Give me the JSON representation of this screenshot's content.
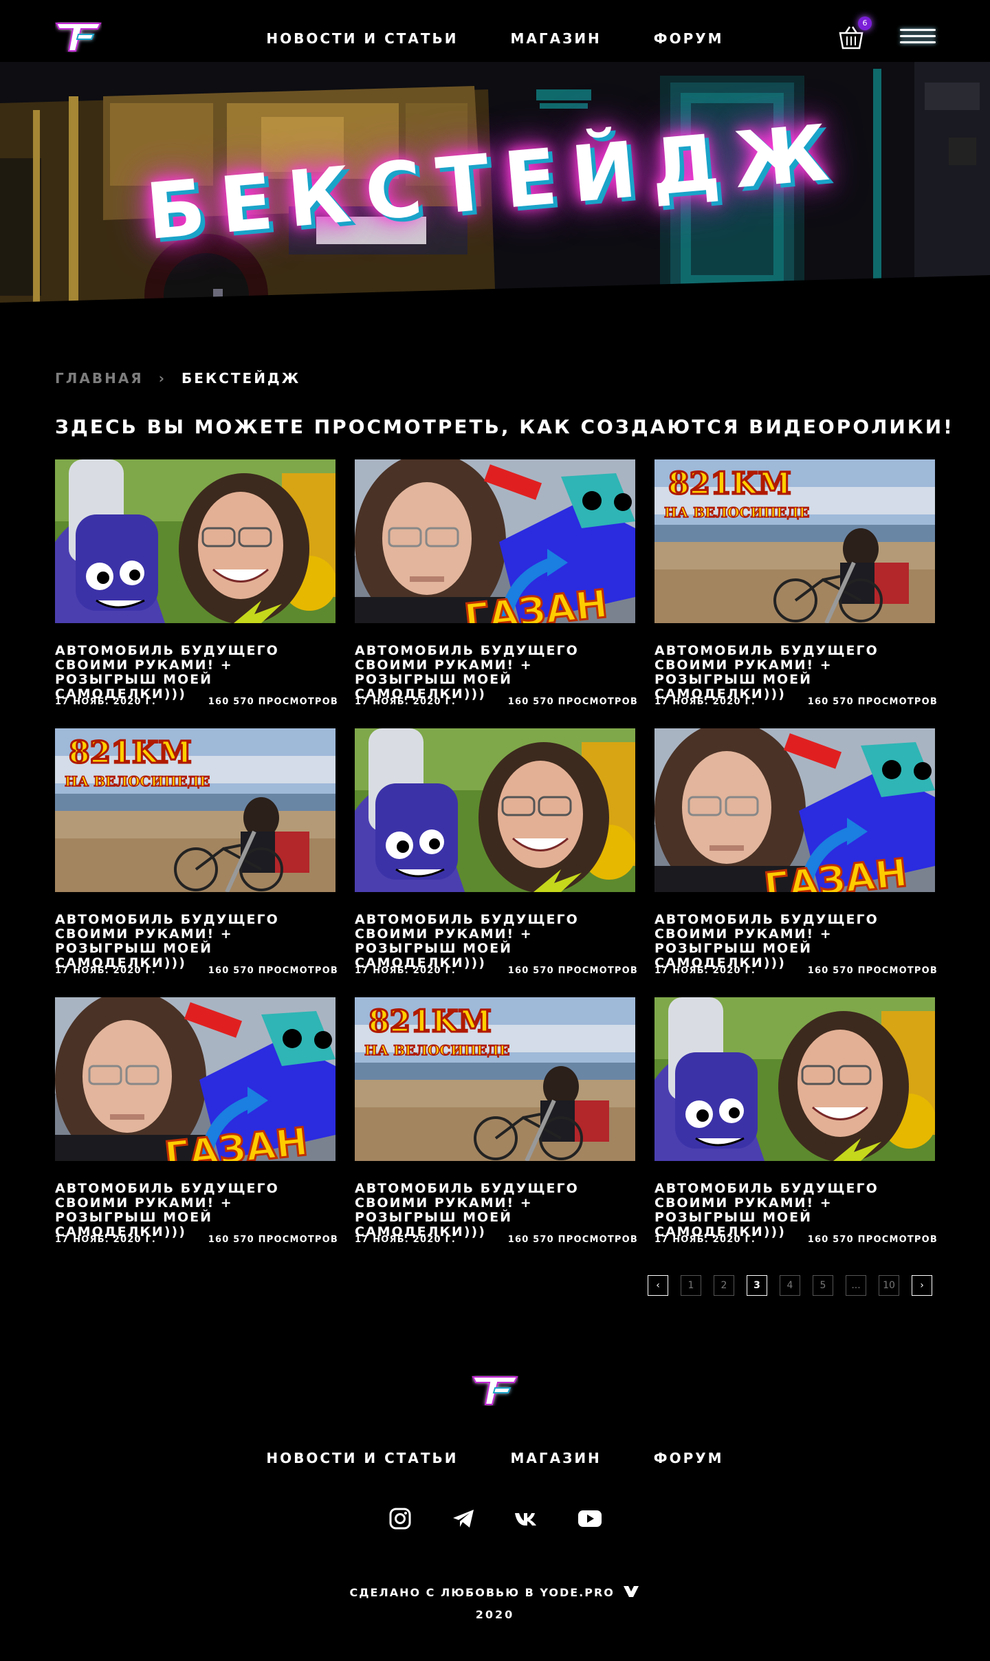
{
  "header": {
    "logo_icon": "tf-logo-icon",
    "nav": [
      "НОВОСТИ И СТАТЬИ",
      "МАГАЗИН",
      "ФОРУМ"
    ],
    "cart_icon": "basket-icon",
    "cart_count": "6",
    "menu_icon": "hamburger-menu-icon",
    "accent_color": "#a855f7"
  },
  "hero": {
    "title": "БЕКСТЕЙДЖ",
    "glow_color": "#ff3cd8",
    "shadow_color": "#1aa3c9"
  },
  "breadcrumb": {
    "home": "ГЛАВНАЯ",
    "separator_icon": "chevron-right-icon",
    "current": "БЕКСТЕЙДЖ"
  },
  "intro": "ЗДЕСЬ ВЫ МОЖЕТЕ ПРОСМОТРЕТЬ, КАК СОЗДАЮТСЯ ВИДЕОРОЛИКИ!",
  "videos": [
    {
      "thumb": "smile",
      "title": "АВТОМОБИЛЬ БУДУЩЕГО СВОИМИ РУКАМИ! + РОЗЫГРЫШ МОЕЙ САМОДЕЛКИ)))",
      "date": "17 НОЯБ. 2020 Г.",
      "views": "160 570 ПРОСМОТРОВ"
    },
    {
      "thumb": "car",
      "title": "АВТОМОБИЛЬ БУДУЩЕГО СВОИМИ РУКАМИ! + РОЗЫГРЫШ МОЕЙ САМОДЕЛКИ)))",
      "date": "17 НОЯБ. 2020 Г.",
      "views": "160 570 ПРОСМОТРОВ"
    },
    {
      "thumb": "bike",
      "overlay_km": "821KM",
      "overlay_sub": "НА ВЕЛОСИПЕДЕ",
      "title": "АВТОМОБИЛЬ БУДУЩЕГО СВОИМИ РУКАМИ! + РОЗЫГРЫШ МОЕЙ САМОДЕЛКИ)))",
      "date": "17 НОЯБ. 2020 Г.",
      "views": "160 570 ПРОСМОТРОВ"
    },
    {
      "thumb": "bike",
      "overlay_km": "821KM",
      "overlay_sub": "НА ВЕЛОСИПЕДЕ",
      "title": "АВТОМОБИЛЬ БУДУЩЕГО СВОИМИ РУКАМИ! + РОЗЫГРЫШ МОЕЙ САМОДЕЛКИ)))",
      "date": "17 НОЯБ. 2020 Г.",
      "views": "160 570 ПРОСМОТРОВ"
    },
    {
      "thumb": "smile",
      "title": "АВТОМОБИЛЬ БУДУЩЕГО СВОИМИ РУКАМИ! + РОЗЫГРЫШ МОЕЙ САМОДЕЛКИ)))",
      "date": "17 НОЯБ. 2020 Г.",
      "views": "160 570 ПРОСМОТРОВ"
    },
    {
      "thumb": "car",
      "title": "АВТОМОБИЛЬ БУДУЩЕГО СВОИМИ РУКАМИ! + РОЗЫГРЫШ МОЕЙ САМОДЕЛКИ)))",
      "date": "17 НОЯБ. 2020 Г.",
      "views": "160 570 ПРОСМОТРОВ"
    },
    {
      "thumb": "car",
      "title": "АВТОМОБИЛЬ БУДУЩЕГО СВОИМИ РУКАМИ! + РОЗЫГРЫШ МОЕЙ САМОДЕЛКИ)))",
      "date": "17 НОЯБ. 2020 Г.",
      "views": "160 570 ПРОСМОТРОВ"
    },
    {
      "thumb": "bike",
      "overlay_km": "821KM",
      "overlay_sub": "НА ВЕЛОСИПЕДЕ",
      "title": "АВТОМОБИЛЬ БУДУЩЕГО СВОИМИ РУКАМИ! + РОЗЫГРЫШ МОЕЙ САМОДЕЛКИ)))",
      "date": "17 НОЯБ. 2020 Г.",
      "views": "160 570 ПРОСМОТРОВ"
    },
    {
      "thumb": "smile",
      "title": "АВТОМОБИЛЬ БУДУЩЕГО СВОИМИ РУКАМИ! + РОЗЫГРЫШ МОЕЙ САМОДЕЛКИ)))",
      "date": "17 НОЯБ. 2020 Г.",
      "views": "160 570 ПРОСМОТРОВ"
    }
  ],
  "car_overlay": "ГАЗАН",
  "pagination": {
    "prev_icon": "chevron-left-icon",
    "next_icon": "chevron-right-icon",
    "pages": [
      "1",
      "2",
      "3",
      "4",
      "5",
      "...",
      "10"
    ],
    "current": "3"
  },
  "footer": {
    "logo_icon": "tf-logo-icon",
    "nav": [
      "НОВОСТИ И СТАТЬИ",
      "МАГАЗИН",
      "ФОРУМ"
    ],
    "socials": [
      "instagram-icon",
      "telegram-icon",
      "vk-icon",
      "youtube-icon"
    ],
    "credits": "СДЕЛАНО С ЛЮБОВЬЮ В YODE.PRO",
    "credits_icon": "yode-logo-icon",
    "year": "2020"
  }
}
